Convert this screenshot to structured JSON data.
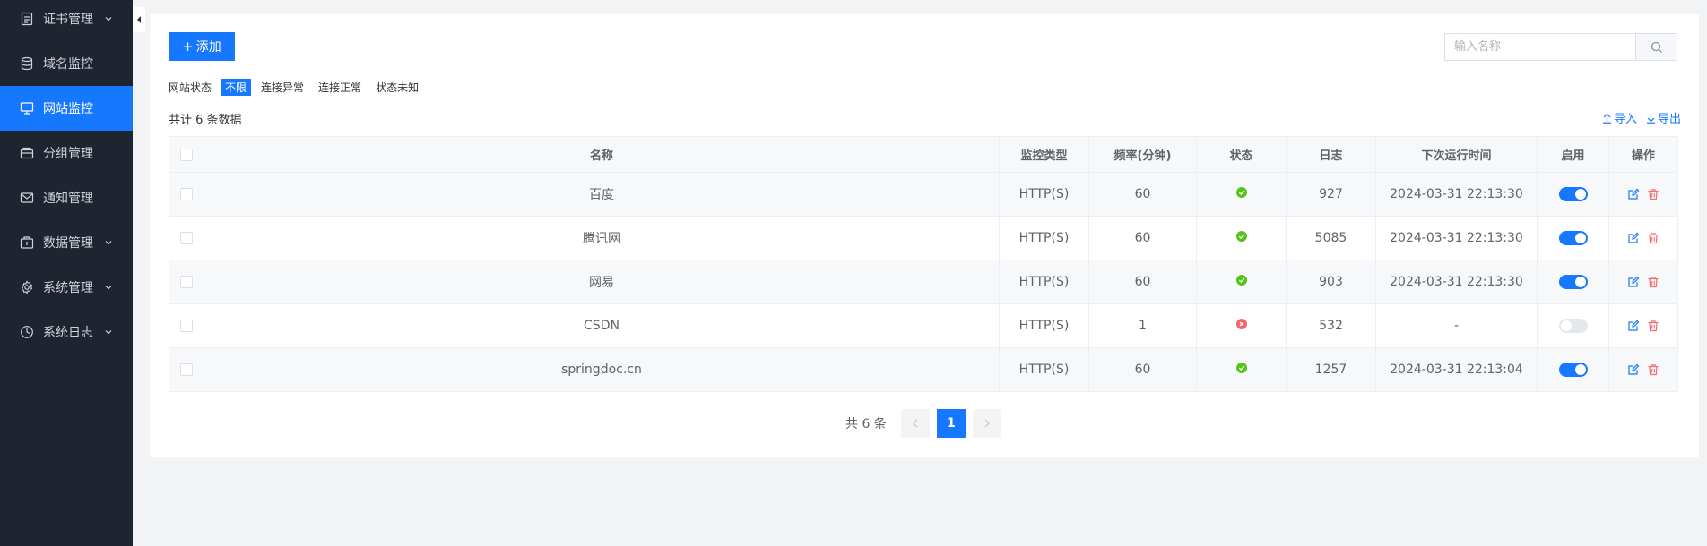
{
  "sidebar": {
    "items": [
      {
        "label": "证书管理",
        "icon": "document-icon",
        "has_chevron": true,
        "active": false
      },
      {
        "label": "域名监控",
        "icon": "database-icon",
        "has_chevron": false,
        "active": false
      },
      {
        "label": "网站监控",
        "icon": "monitor-icon",
        "has_chevron": false,
        "active": true
      },
      {
        "label": "分组管理",
        "icon": "folder-icon",
        "has_chevron": false,
        "active": false
      },
      {
        "label": "通知管理",
        "icon": "mail-icon",
        "has_chevron": false,
        "active": false
      },
      {
        "label": "数据管理",
        "icon": "box-icon",
        "has_chevron": true,
        "active": false
      },
      {
        "label": "系统管理",
        "icon": "gear-icon",
        "has_chevron": true,
        "active": false
      },
      {
        "label": "系统日志",
        "icon": "clock-icon",
        "has_chevron": true,
        "active": false
      }
    ]
  },
  "toolbar": {
    "add_label": "添加",
    "search_placeholder": "输入名称"
  },
  "filter": {
    "label": "网站状态",
    "options": [
      "不限",
      "连接异常",
      "连接正常",
      "状态未知"
    ],
    "selected": "不限"
  },
  "summary": {
    "total_text": "共计 6 条数据",
    "import_label": "导入",
    "export_label": "导出"
  },
  "table": {
    "columns": [
      "名称",
      "监控类型",
      "频率(分钟)",
      "状态",
      "日志",
      "下次运行时间",
      "启用",
      "操作"
    ],
    "rows": [
      {
        "name": "百度",
        "type": "HTTP(S)",
        "frequency": "60",
        "status": "ok",
        "log": "927",
        "next_run": "2024-03-31 22:13:30",
        "enabled": true
      },
      {
        "name": "腾讯网",
        "type": "HTTP(S)",
        "frequency": "60",
        "status": "ok",
        "log": "5085",
        "next_run": "2024-03-31 22:13:30",
        "enabled": true
      },
      {
        "name": "网易",
        "type": "HTTP(S)",
        "frequency": "60",
        "status": "ok",
        "log": "903",
        "next_run": "2024-03-31 22:13:30",
        "enabled": true
      },
      {
        "name": "CSDN",
        "type": "HTTP(S)",
        "frequency": "1",
        "status": "error",
        "log": "532",
        "next_run": "-",
        "enabled": false
      },
      {
        "name": "springdoc.cn",
        "type": "HTTP(S)",
        "frequency": "60",
        "status": "ok",
        "log": "1257",
        "next_run": "2024-03-31 22:13:04",
        "enabled": true
      }
    ]
  },
  "pagination": {
    "total_text": "共 6 条",
    "current_page": "1"
  },
  "colors": {
    "primary": "#1677ff",
    "sidebar_bg": "#1e2430",
    "status_ok": "#52c41a",
    "status_error": "#f5626a",
    "delete_red": "#f56c6c"
  }
}
